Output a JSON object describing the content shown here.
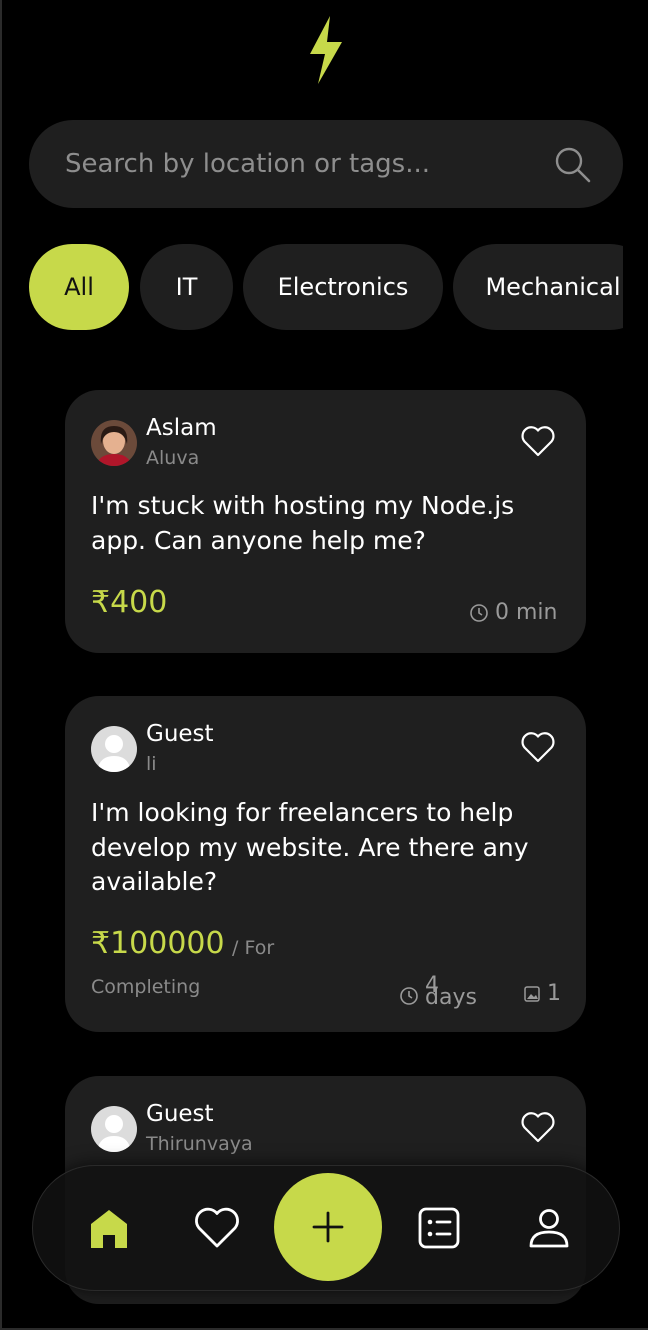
{
  "search": {
    "placeholder": "Search by location or tags..."
  },
  "categories": [
    "All",
    "IT",
    "Electronics",
    "Mechanical"
  ],
  "posts": [
    {
      "name": "Aslam",
      "location": "Aluva",
      "text": "I'm stuck with hosting my Node.js app. Can anyone help me?",
      "price": "₹400",
      "time": "0 min"
    },
    {
      "name": "Guest",
      "location": "li",
      "text": "I'm looking for freelancers to help develop my website. Are there any available?",
      "price": "₹100000",
      "unit_line1": "/ For",
      "unit_line2": "Completing",
      "time_num": "4",
      "time_unit": "days",
      "images": "1"
    },
    {
      "name": "Guest",
      "location": "Thirunvaya"
    }
  ],
  "colors": {
    "accent": "#c7d94a",
    "card": "#1f1f1f",
    "background": "#000000"
  },
  "icons": [
    "bolt-icon",
    "search-icon",
    "heart-icon",
    "clock-icon",
    "image-icon",
    "home-icon",
    "favorites-icon",
    "plus-icon",
    "list-icon",
    "profile-icon"
  ]
}
